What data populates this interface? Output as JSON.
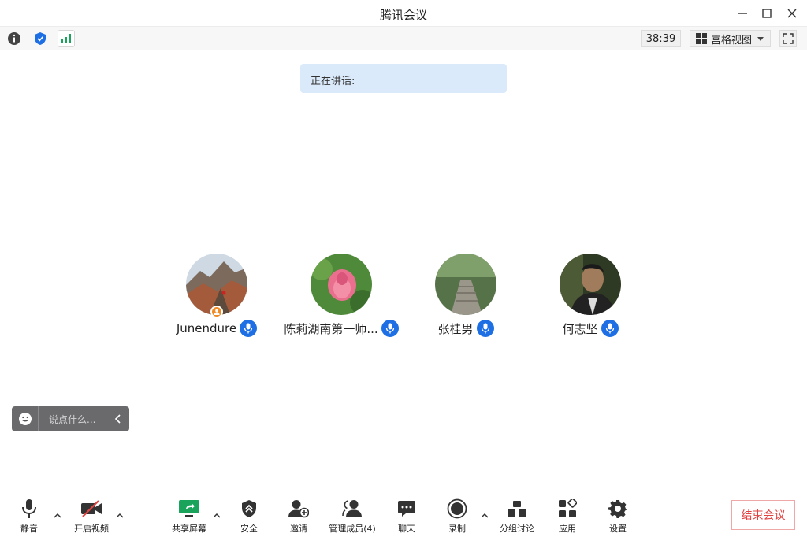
{
  "window": {
    "title": "腾讯会议"
  },
  "infobar": {
    "timer": "38:39",
    "view_label": "宫格视图"
  },
  "speaking": {
    "label": "正在讲话:"
  },
  "participants": [
    {
      "name": "Junendure"
    },
    {
      "name": "陈莉湖南第一师..."
    },
    {
      "name": "张桂男"
    },
    {
      "name": "何志坚"
    }
  ],
  "chat": {
    "placeholder": "说点什么..."
  },
  "toolbar": {
    "mute": "静音",
    "video": "开启视频",
    "share": "共享屏幕",
    "security": "安全",
    "invite": "邀请",
    "members": "管理成员(4)",
    "chat": "聊天",
    "record": "录制",
    "breakout": "分组讨论",
    "apps": "应用",
    "settings": "设置"
  },
  "end_meeting": "结束会议",
  "colors": {
    "accent": "#1e6fe3",
    "share_green": "#1aa35b",
    "end_red": "#e14343",
    "host_orange": "#f08a24"
  }
}
